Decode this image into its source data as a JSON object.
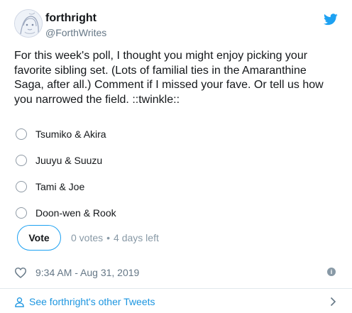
{
  "author": {
    "name": "forthright",
    "handle": "@ForthWrites"
  },
  "tweet": {
    "text": "For this week's poll, I thought you might enjoy picking your favorite sibling set. (Lots of familial ties in the Amaranthine Saga, after all.) Comment if I missed your fave. Or tell us how you narrowed the field. ::twinkle::"
  },
  "poll": {
    "options": [
      {
        "label": "Tsumiko & Akira"
      },
      {
        "label": "Juuyu & Suuzu"
      },
      {
        "label": "Tami & Joe"
      },
      {
        "label": "Doon-wen & Rook"
      }
    ],
    "vote_label": "Vote",
    "votes": "0 votes",
    "separator": "•",
    "time_left": "4 days left"
  },
  "meta": {
    "timestamp": "9:34 AM - Aug 31, 2019",
    "info_glyph": "i"
  },
  "footer": {
    "link_text": "See forthright's other Tweets"
  },
  "colors": {
    "accent": "#1da1f2",
    "link": "#1b95e0",
    "muted": "#657786"
  },
  "icons": {
    "brand": "twitter-bird-icon",
    "like": "heart-icon",
    "info": "info-icon",
    "profile": "person-icon",
    "next": "chevron-right-icon"
  }
}
